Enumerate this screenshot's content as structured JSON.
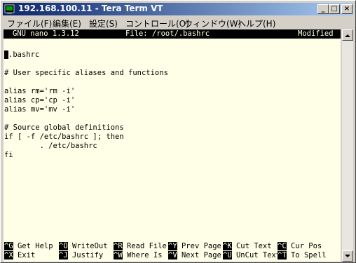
{
  "window": {
    "title": "192.168.100.11 - Tera Term VT",
    "icon": "teraterm-app-icon",
    "controls": [
      "_",
      "□",
      "×"
    ]
  },
  "menu": [
    {
      "label": "ファイル(F)"
    },
    {
      "label": "編集(E)"
    },
    {
      "label": "設定(S)"
    },
    {
      "label": "コントロール(O)"
    },
    {
      "label": "ウィンドウ(W)"
    },
    {
      "label": "ヘルプ(H)"
    }
  ],
  "nano": {
    "status": {
      "app": "GNU nano 1.3.12",
      "file": "File: /root/.bashrc",
      "state": "Modified"
    },
    "lines": [
      {
        "text": ".bashrc",
        "cursor": true
      },
      {
        "text": ""
      },
      {
        "text": "# User specific aliases and functions"
      },
      {
        "text": ""
      },
      {
        "text": "alias rm='rm -i'"
      },
      {
        "text": "alias cp='cp -i'"
      },
      {
        "text": "alias mv='mv -i'"
      },
      {
        "text": ""
      },
      {
        "text": "# Source global definitions"
      },
      {
        "text": "if [ -f /etc/bashrc ]; then"
      },
      {
        "text": "        . /etc/bashrc"
      },
      {
        "text": "fi"
      }
    ],
    "shortcuts_row1": [
      {
        "key": "^G",
        "label": "Get Help"
      },
      {
        "key": "^O",
        "label": "WriteOut"
      },
      {
        "key": "^R",
        "label": "Read File"
      },
      {
        "key": "^Y",
        "label": "Prev Page"
      },
      {
        "key": "^K",
        "label": "Cut Text"
      },
      {
        "key": "^C",
        "label": "Cur Pos"
      }
    ],
    "shortcuts_row2": [
      {
        "key": "^X",
        "label": "Exit"
      },
      {
        "key": "^J",
        "label": "Justify"
      },
      {
        "key": "^W",
        "label": "Where Is"
      },
      {
        "key": "^V",
        "label": "Next Page"
      },
      {
        "key": "^U",
        "label": "UnCut Text"
      },
      {
        "key": "^T",
        "label": "To Spell"
      }
    ]
  },
  "colors": {
    "title_gradient_start": "#0a246a",
    "title_gradient_end": "#a6caf0",
    "terminal_bg": "#ffffe8",
    "terminal_fg": "#000000"
  }
}
